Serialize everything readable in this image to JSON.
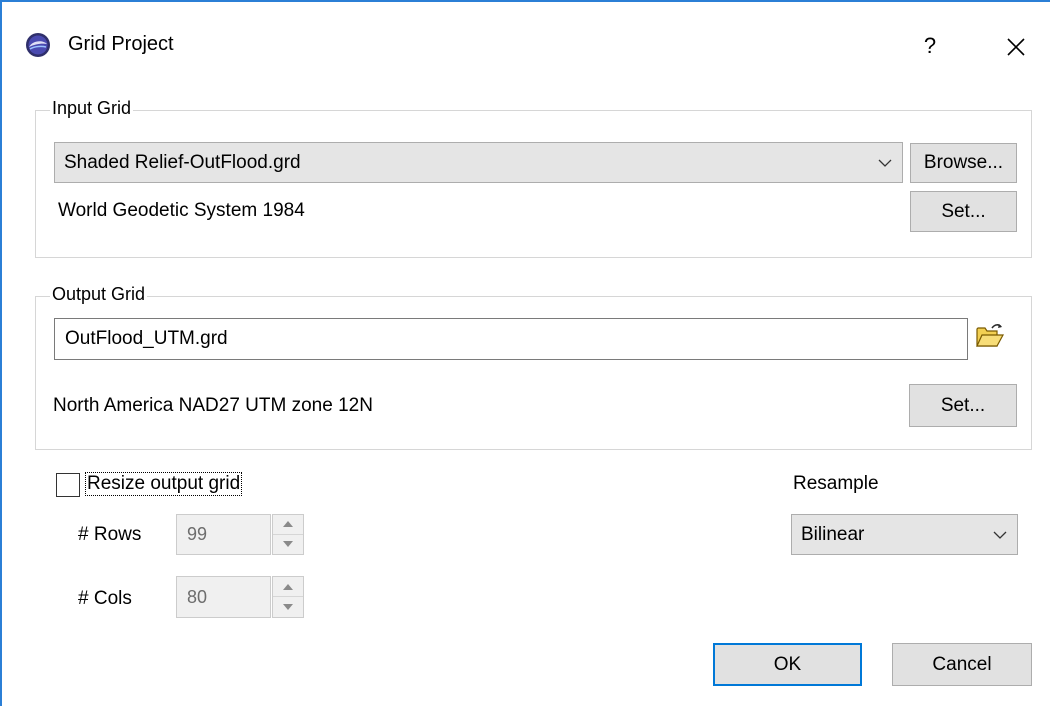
{
  "window": {
    "title": "Grid Project",
    "help_label": "?",
    "close_label": "✕"
  },
  "input_grid": {
    "group_label": "Input Grid",
    "selected_file": "Shaded Relief-OutFlood.grd",
    "browse_label": "Browse...",
    "projection": "World Geodetic System 1984",
    "set_label": "Set..."
  },
  "output_grid": {
    "group_label": "Output Grid",
    "filename": "OutFlood_UTM.grd",
    "projection": "North America NAD27 UTM zone 12N",
    "set_label": "Set..."
  },
  "resize": {
    "checkbox_label": "Resize output grid",
    "checked": false,
    "rows_label": "# Rows",
    "rows_value": "99",
    "cols_label": "# Cols",
    "cols_value": "80"
  },
  "resample": {
    "label": "Resample",
    "selected": "Bilinear"
  },
  "buttons": {
    "ok": "OK",
    "cancel": "Cancel"
  },
  "icons": {
    "app": "app-logo-icon",
    "folder": "open-folder-icon",
    "dropdown": "chevron-down-icon",
    "spin_up": "spin-up-icon",
    "spin_down": "spin-down-icon"
  },
  "colors": {
    "accent": "#0078d7",
    "folder": "#e8b820"
  }
}
